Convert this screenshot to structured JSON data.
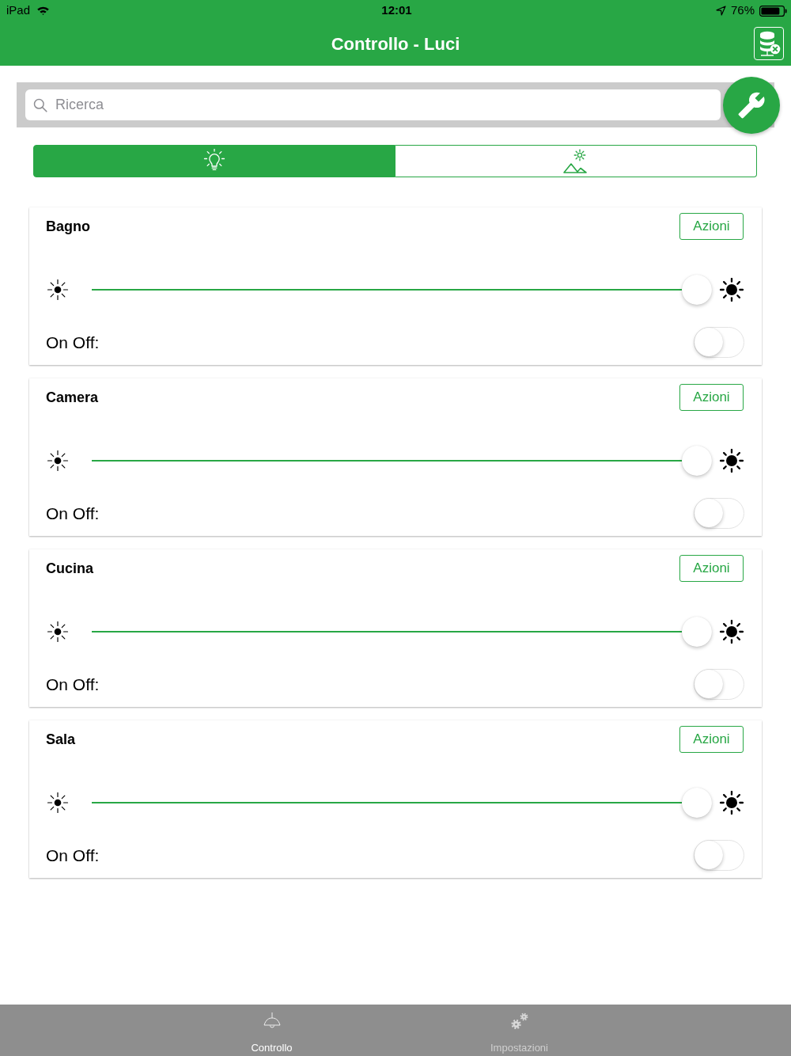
{
  "status_bar": {
    "device": "iPad",
    "time": "12:01",
    "battery": "76%"
  },
  "nav_bar": {
    "title": "Controllo - Luci"
  },
  "search": {
    "placeholder": "Ricerca"
  },
  "segments": [
    {
      "kind": "bulb",
      "selected": true
    },
    {
      "kind": "landscape",
      "selected": false
    }
  ],
  "rooms": [
    {
      "name": "Bagno",
      "button": "Azioni",
      "level": 1,
      "switch_label": "On Off:",
      "on": false
    },
    {
      "name": "Camera",
      "button": "Azioni",
      "level": 1,
      "switch_label": "On Off:",
      "on": false
    },
    {
      "name": "Cucina",
      "button": "Azioni",
      "level": 1,
      "switch_label": "On Off:",
      "on": false
    },
    {
      "name": "Sala",
      "button": "Azioni",
      "level": 1,
      "switch_label": "On Off:",
      "on": false
    }
  ],
  "tab_bar": [
    {
      "label": "Controllo",
      "kind": "lamp",
      "selected": true
    },
    {
      "label": "Impostazioni",
      "kind": "gears",
      "selected": false
    }
  ]
}
